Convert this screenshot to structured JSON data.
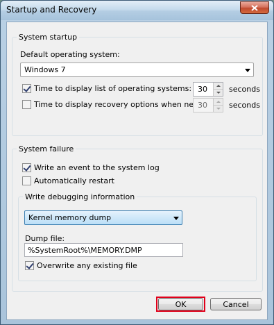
{
  "window": {
    "title": "Startup and Recovery"
  },
  "system_startup": {
    "legend": "System startup",
    "default_os_label": "Default operating system:",
    "default_os_value": "Windows 7",
    "show_list": {
      "label": "Time to display list of operating systems:",
      "checked": true,
      "value": "30",
      "unit": "seconds"
    },
    "show_recovery": {
      "label": "Time to display recovery options when needed:",
      "checked": false,
      "value": "30",
      "unit": "seconds"
    }
  },
  "system_failure": {
    "legend": "System failure",
    "write_event": {
      "label": "Write an event to the system log",
      "checked": true
    },
    "auto_restart": {
      "label": "Automatically restart",
      "checked": false
    },
    "debugging": {
      "legend": "Write debugging information",
      "dump_type": "Kernel memory dump",
      "dump_file_label": "Dump file:",
      "dump_file_value": "%SystemRoot%\\MEMORY.DMP",
      "overwrite": {
        "label": "Overwrite any existing file",
        "checked": true
      }
    }
  },
  "buttons": {
    "ok": "OK",
    "cancel": "Cancel"
  },
  "colors": {
    "highlight": "#e0001a",
    "close": "#c04a2f"
  }
}
